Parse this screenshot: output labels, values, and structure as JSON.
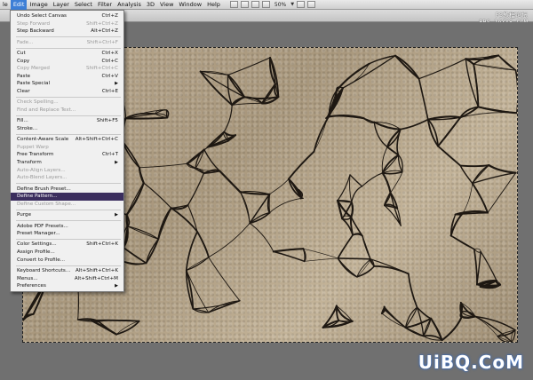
{
  "menubar": {
    "items": [
      {
        "label": "le",
        "active": false
      },
      {
        "label": "Edit",
        "active": true
      },
      {
        "label": "Image",
        "active": false
      },
      {
        "label": "Layer",
        "active": false
      },
      {
        "label": "Select",
        "active": false
      },
      {
        "label": "Filter",
        "active": false
      },
      {
        "label": "Analysis",
        "active": false
      },
      {
        "label": "3D",
        "active": false
      },
      {
        "label": "View",
        "active": false
      },
      {
        "label": "Window",
        "active": false
      },
      {
        "label": "Help",
        "active": false
      }
    ],
    "zoom": "50%"
  },
  "watermark": {
    "top_line1": "PS教程论坛",
    "top_line2": "BBS.16XX8.COM",
    "bottom": "UiBQ.CoM"
  },
  "edit_menu": [
    {
      "label": "Undo Select Canvas",
      "shortcut": "Ctrl+Z",
      "disabled": false
    },
    {
      "label": "Step Forward",
      "shortcut": "Shift+Ctrl+Z",
      "disabled": true
    },
    {
      "label": "Step Backward",
      "shortcut": "Alt+Ctrl+Z",
      "disabled": false
    },
    {
      "sep": true
    },
    {
      "label": "Fade...",
      "shortcut": "Shift+Ctrl+F",
      "disabled": true
    },
    {
      "sep": true
    },
    {
      "label": "Cut",
      "shortcut": "Ctrl+X",
      "disabled": false
    },
    {
      "label": "Copy",
      "shortcut": "Ctrl+C",
      "disabled": false
    },
    {
      "label": "Copy Merged",
      "shortcut": "Shift+Ctrl+C",
      "disabled": true
    },
    {
      "label": "Paste",
      "shortcut": "Ctrl+V",
      "disabled": false
    },
    {
      "label": "Paste Special",
      "shortcut": "",
      "disabled": false,
      "submenu": true
    },
    {
      "label": "Clear",
      "shortcut": "Ctrl+E",
      "disabled": false
    },
    {
      "sep": true
    },
    {
      "label": "Check Spelling...",
      "shortcut": "",
      "disabled": true
    },
    {
      "label": "Find and Replace Text...",
      "shortcut": "",
      "disabled": true
    },
    {
      "sep": true
    },
    {
      "label": "Fill...",
      "shortcut": "Shift+F5",
      "disabled": false
    },
    {
      "label": "Stroke...",
      "shortcut": "",
      "disabled": false
    },
    {
      "sep": true
    },
    {
      "label": "Content-Aware Scale",
      "shortcut": "Alt+Shift+Ctrl+C",
      "disabled": false
    },
    {
      "label": "Puppet Warp",
      "shortcut": "",
      "disabled": true
    },
    {
      "label": "Free Transform",
      "shortcut": "Ctrl+T",
      "disabled": false
    },
    {
      "label": "Transform",
      "shortcut": "",
      "disabled": false,
      "submenu": true
    },
    {
      "label": "Auto-Align Layers...",
      "shortcut": "",
      "disabled": true
    },
    {
      "label": "Auto-Blend Layers...",
      "shortcut": "",
      "disabled": true
    },
    {
      "sep": true
    },
    {
      "label": "Define Brush Preset...",
      "shortcut": "",
      "disabled": false
    },
    {
      "label": "Define Pattern...",
      "shortcut": "",
      "disabled": false,
      "highlight": true
    },
    {
      "label": "Define Custom Shape...",
      "shortcut": "",
      "disabled": true
    },
    {
      "sep": true
    },
    {
      "label": "Purge",
      "shortcut": "",
      "disabled": false,
      "submenu": true
    },
    {
      "sep": true
    },
    {
      "label": "Adobe PDF Presets...",
      "shortcut": "",
      "disabled": false
    },
    {
      "label": "Preset Manager...",
      "shortcut": "",
      "disabled": false
    },
    {
      "sep": true
    },
    {
      "label": "Color Settings...",
      "shortcut": "Shift+Ctrl+K",
      "disabled": false
    },
    {
      "label": "Assign Profile...",
      "shortcut": "",
      "disabled": false
    },
    {
      "label": "Convert to Profile...",
      "shortcut": "",
      "disabled": false
    },
    {
      "sep": true
    },
    {
      "label": "Keyboard Shortcuts...",
      "shortcut": "Alt+Shift+Ctrl+K",
      "disabled": false
    },
    {
      "label": "Menus...",
      "shortcut": "Alt+Shift+Ctrl+M",
      "disabled": false
    },
    {
      "label": "Preferences",
      "shortcut": "",
      "disabled": false,
      "submenu": true
    }
  ]
}
